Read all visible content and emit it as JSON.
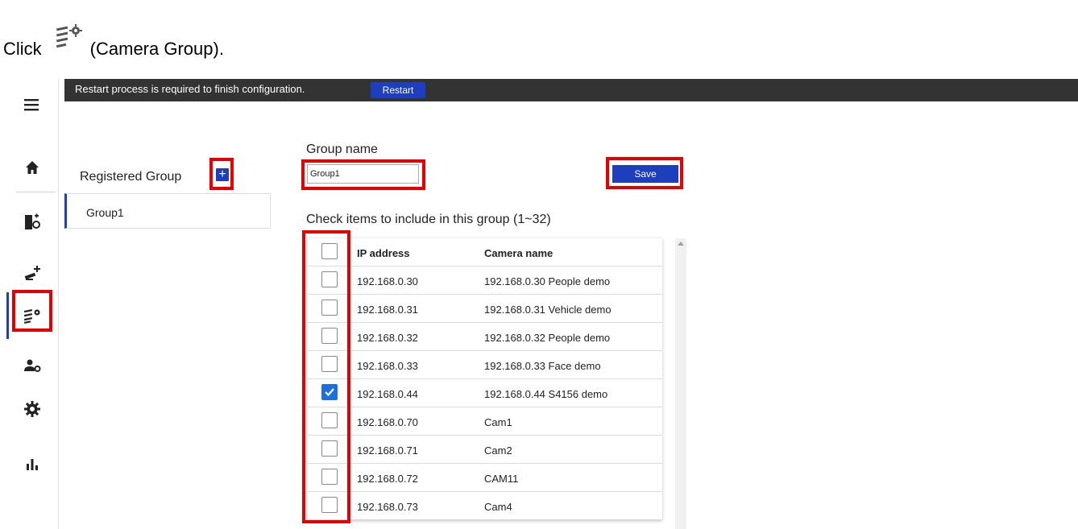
{
  "instruction": {
    "click_word": "Click",
    "target_label": "(Camera Group).",
    "icon": "camera-group-icon"
  },
  "topbar": {
    "message": "Restart process is required to finish configuration.",
    "restart_label": "Restart"
  },
  "sidebar": {
    "items": [
      {
        "name": "menu-icon"
      },
      {
        "name": "home-icon"
      },
      {
        "name": "device-settings-icon"
      },
      {
        "name": "add-camera-icon"
      },
      {
        "name": "camera-group-icon",
        "active": true
      },
      {
        "name": "user-settings-icon"
      },
      {
        "name": "gear-icon"
      },
      {
        "name": "statistics-icon"
      }
    ]
  },
  "registered_group": {
    "title": "Registered Group",
    "add_label": "+",
    "groups": [
      "Group1"
    ]
  },
  "group_form": {
    "name_label": "Group name",
    "name_value": "Group1",
    "save_label": "Save",
    "check_label": "Check items to include in this group (1~32)"
  },
  "table": {
    "headers": {
      "ip": "IP address",
      "name": "Camera name"
    },
    "rows": [
      {
        "ip": "192.168.0.30",
        "name": "192.168.0.30 People demo",
        "checked": false
      },
      {
        "ip": "192.168.0.31",
        "name": "192.168.0.31 Vehicle demo",
        "checked": false
      },
      {
        "ip": "192.168.0.32",
        "name": "192.168.0.32 People demo",
        "checked": false
      },
      {
        "ip": "192.168.0.33",
        "name": "192.168.0.33 Face demo",
        "checked": false
      },
      {
        "ip": "192.168.0.44",
        "name": "192.168.0.44 S4156 demo",
        "checked": true
      },
      {
        "ip": "192.168.0.70",
        "name": "Cam1",
        "checked": false
      },
      {
        "ip": "192.168.0.71",
        "name": "Cam2",
        "checked": false
      },
      {
        "ip": "192.168.0.72",
        "name": "CAM11",
        "checked": false
      },
      {
        "ip": "192.168.0.73",
        "name": "Cam4",
        "checked": false
      }
    ]
  },
  "colors": {
    "accent": "#1d3fbd",
    "highlight": "#e60000",
    "topbar": "#333333",
    "checkbox_checked": "#1d6fe0"
  }
}
